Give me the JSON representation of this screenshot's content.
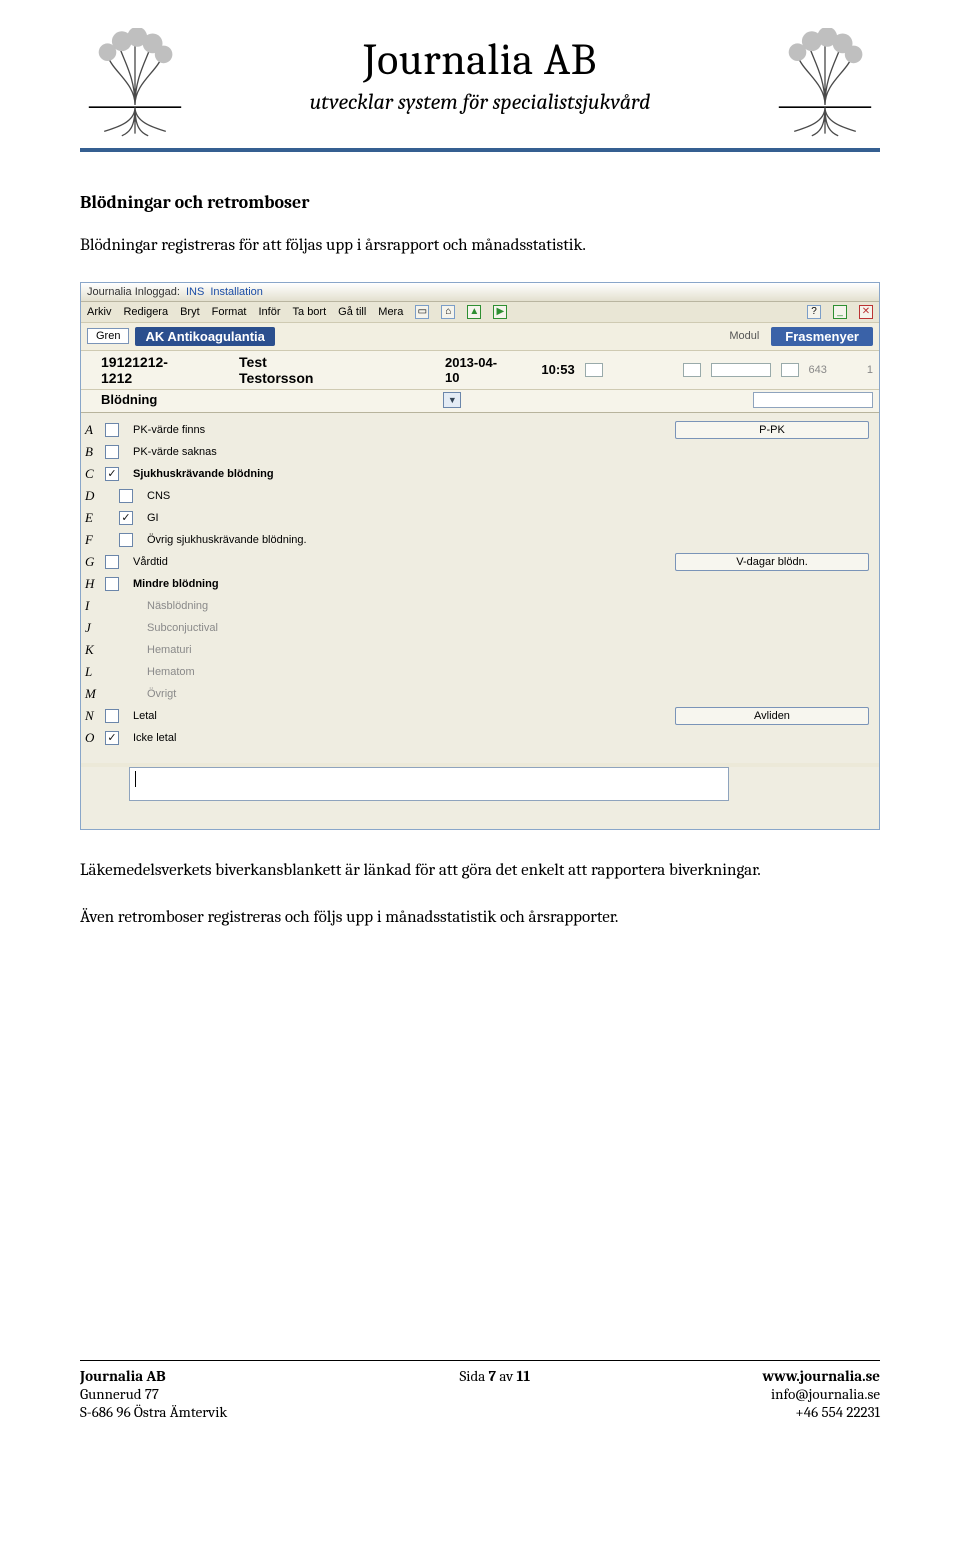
{
  "header": {
    "company": "Journalia AB",
    "tagline": "utvecklar system för specialistsjukvård"
  },
  "doc": {
    "section_title": "Blödningar och retromboser",
    "p1": "Blödningar registreras för att följas upp i årsrapport och månadsstatistik.",
    "p2": "Läkemedelsverkets biverkansblankett är länkad för att göra det enkelt att rapportera biverkningar.",
    "p3": "Även retromboser registreras och följs upp i månadsstatistik och årsrapporter."
  },
  "shot": {
    "titlebar_prefix": "Journalia   Inloggad:",
    "titlebar_user": "INS",
    "titlebar_suffix": "Installation",
    "menu": [
      "Arkiv",
      "Redigera",
      "Bryt",
      "Format",
      "Inför",
      "Ta bort",
      "Gå till",
      "Mera"
    ],
    "gren": "Gren",
    "module_label": "AK Antikoagulantia",
    "modul_text": "Modul",
    "frasmenyer": "Frasmenyer",
    "patient_id": "19121212-1212",
    "patient_name": "Test Testorsson",
    "date": "2013-04-10",
    "time": "10:53",
    "meta_a": "643",
    "meta_b": "1",
    "category": "Blödning",
    "letters": [
      "A",
      "B",
      "C",
      "D",
      "E",
      "F",
      "G",
      "H",
      "I",
      "J",
      "K",
      "L",
      "M",
      "N",
      "O"
    ],
    "rows": [
      {
        "label": "PK-värde finns",
        "bold": false,
        "indent": 0,
        "gray": false,
        "cb": true,
        "checked": false
      },
      {
        "label": "PK-värde saknas",
        "bold": false,
        "indent": 0,
        "gray": false,
        "cb": true,
        "checked": false
      },
      {
        "label": "Sjukhuskrävande blödning",
        "bold": true,
        "indent": 0,
        "gray": false,
        "cb": true,
        "checked": true
      },
      {
        "label": "CNS",
        "bold": false,
        "indent": 1,
        "gray": false,
        "cb": true,
        "checked": false
      },
      {
        "label": "GI",
        "bold": false,
        "indent": 1,
        "gray": false,
        "cb": true,
        "checked": true
      },
      {
        "label": "Övrig sjukhuskrävande blödning.",
        "bold": false,
        "indent": 1,
        "gray": false,
        "cb": true,
        "checked": false
      },
      {
        "label": "Vårdtid",
        "bold": false,
        "indent": 0,
        "gray": false,
        "cb": true,
        "checked": false
      },
      {
        "label": "Mindre blödning",
        "bold": true,
        "indent": 0,
        "gray": false,
        "cb": true,
        "checked": false
      },
      {
        "label": "Näsblödning",
        "bold": false,
        "indent": 1,
        "gray": true,
        "cb": false,
        "checked": false
      },
      {
        "label": "Subconjuctival",
        "bold": false,
        "indent": 1,
        "gray": true,
        "cb": false,
        "checked": false
      },
      {
        "label": "Hematuri",
        "bold": false,
        "indent": 1,
        "gray": true,
        "cb": false,
        "checked": false
      },
      {
        "label": "Hematom",
        "bold": false,
        "indent": 1,
        "gray": true,
        "cb": false,
        "checked": false
      },
      {
        "label": "Övrigt",
        "bold": false,
        "indent": 1,
        "gray": true,
        "cb": false,
        "checked": false
      },
      {
        "label": "Letal",
        "bold": false,
        "indent": 0,
        "gray": false,
        "cb": true,
        "checked": false
      },
      {
        "label": "Icke letal",
        "bold": false,
        "indent": 0,
        "gray": false,
        "cb": true,
        "checked": true
      }
    ],
    "rbtn_ppk": "P-PK",
    "rbtn_vdagar": "V-dagar blödn.",
    "rbtn_avliden": "Avliden"
  },
  "footer": {
    "l1": "Journalia AB",
    "l2": "Gunnerud 77",
    "l3": "S-686 96 Östra Ämtervik",
    "mid_pre": "Sida ",
    "mid_n": "7",
    "mid_mid": " av ",
    "mid_t": "11",
    "r1": "www.journalia.se",
    "r2": "info@journalia.se",
    "r3": "+46 554 22231"
  }
}
